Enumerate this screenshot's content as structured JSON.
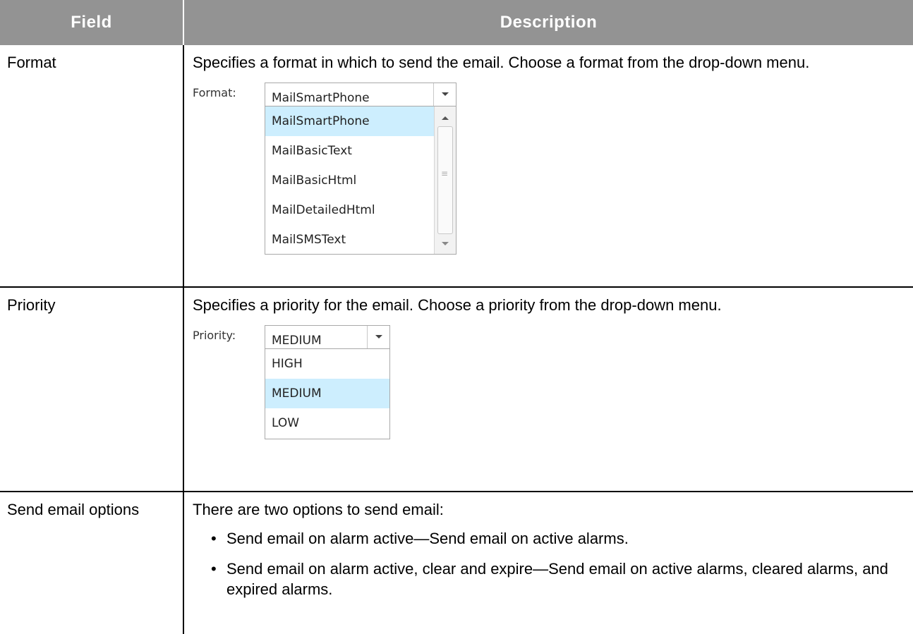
{
  "table": {
    "headers": {
      "field": "Field",
      "description": "Description"
    },
    "rows": [
      {
        "field": "Format",
        "description": "Specifies a format in which to send the email. Choose a format from the drop-down menu.",
        "widget": {
          "label": "Format:",
          "selected_value": "MailSmartPhone",
          "options": [
            "MailSmartPhone",
            "MailBasicText",
            "MailBasicHtml",
            "MailDetailedHtml",
            "MailSMSText"
          ],
          "highlighted": "MailSmartPhone"
        }
      },
      {
        "field": "Priority",
        "description": "Specifies a priority for the email. Choose a priority from the drop-down menu.",
        "widget": {
          "label": "Priority:",
          "selected_value": "MEDIUM",
          "options": [
            "HIGH",
            "MEDIUM",
            "LOW"
          ],
          "highlighted": "MEDIUM"
        }
      },
      {
        "field": "Send email options",
        "description": "There are two options to send email:",
        "bullets": [
          "Send email on alarm active—Send email on active alarms.",
          "Send email on alarm active, clear and expire—Send email on active alarms, cleared alarms, and expired alarms."
        ]
      }
    ]
  },
  "colors": {
    "header_bg": "#939393",
    "highlight_bg": "#cdeefe"
  },
  "icons": {
    "dropdown_arrow": "chevron-down-icon",
    "scroll_up": "scroll-up-icon",
    "scroll_down": "scroll-down-icon"
  }
}
